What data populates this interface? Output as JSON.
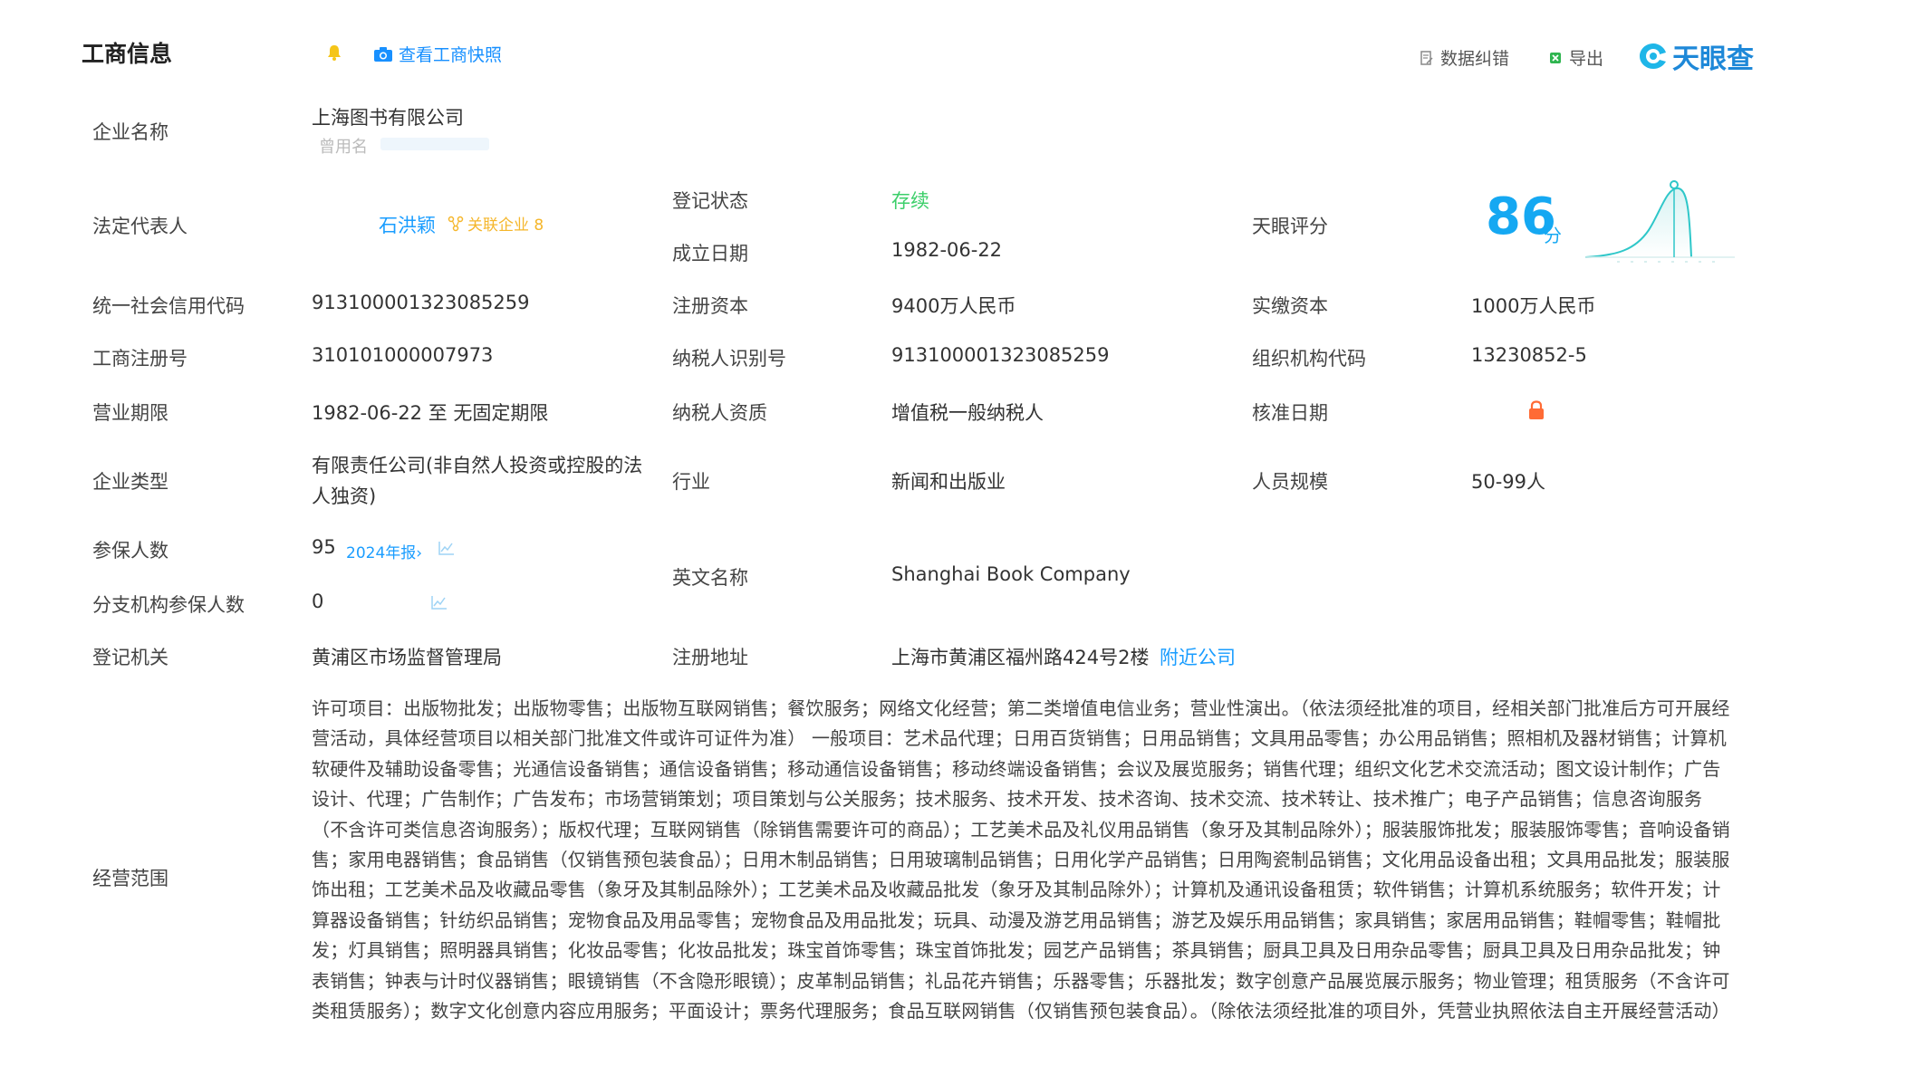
{
  "header": {
    "title": "工商信息",
    "snapshot_label": "查看工商快照",
    "data_correction_label": "数据纠错",
    "export_label": "导出",
    "brand": "天眼查"
  },
  "colors": {
    "accent": "#1a9dff",
    "status_green": "#3ccf6a",
    "score_blue": "#15a8f2",
    "lock_orange": "#ff6b35"
  },
  "rows": {
    "company_name_label": "企业名称",
    "company_name": "上海图书有限公司",
    "former_name_label": "曾用名",
    "legal_rep_label": "法定代表人",
    "legal_rep": "石洪颖",
    "related_companies": "关联企业 8",
    "reg_status_label": "登记状态",
    "reg_status": "存续",
    "founded_label": "成立日期",
    "founded": "1982-06-22",
    "tianyan_score_label": "天眼评分",
    "tianyan_score": "86",
    "tianyan_score_unit": "分",
    "credit_code_label": "统一社会信用代码",
    "credit_code": "913100001323085259",
    "reg_capital_label": "注册资本",
    "reg_capital": "9400万人民币",
    "paid_capital_label": "实缴资本",
    "paid_capital": "1000万人民币",
    "reg_no_label": "工商注册号",
    "reg_no": "310101000007973",
    "taxpayer_id_label": "纳税人识别号",
    "taxpayer_id": "913100001323085259",
    "org_code_label": "组织机构代码",
    "org_code": "13230852-5",
    "biz_term_label": "营业期限",
    "biz_term": "1982-06-22 至 无固定期限",
    "taxpayer_qual_label": "纳税人资质",
    "taxpayer_qual": "增值税一般纳税人",
    "approval_date_label": "核准日期",
    "company_type_label": "企业类型",
    "company_type_line1": "有限责任公司(非自然人投资或控股的法",
    "company_type_line2": "人独资)",
    "industry_label": "行业",
    "industry": "新闻和出版业",
    "staff_size_label": "人员规模",
    "staff_size": "50-99人",
    "insured_label": "参保人数",
    "insured": "95",
    "insured_year": "2024年报›",
    "branch_insured_label": "分支机构参保人数",
    "branch_insured": "0",
    "english_name_label": "英文名称",
    "english_name": "Shanghai Book Company",
    "authority_label": "登记机关",
    "authority": "黄浦区市场监督管理局",
    "address_label": "注册地址",
    "address": "上海市黄浦区福州路424号2楼",
    "nearby_label": "附近公司",
    "scope_label": "经营范围",
    "scope": "许可项目：出版物批发；出版物零售；出版物互联网销售；餐饮服务；网络文化经营；第二类增值电信业务；营业性演出。（依法须经批准的项目，经相关部门批准后方可开展经营活动，具体经营项目以相关部门批准文件或许可证件为准） 一般项目：艺术品代理；日用百货销售；日用品销售；文具用品零售；办公用品销售；照相机及器材销售；计算机软硬件及辅助设备零售；光通信设备销售；通信设备销售；移动通信设备销售；移动终端设备销售；会议及展览服务；销售代理；组织文化艺术交流活动；图文设计制作；广告设计、代理；广告制作；广告发布；市场营销策划；项目策划与公关服务；技术服务、技术开发、技术咨询、技术交流、技术转让、技术推广；电子产品销售；信息咨询服务（不含许可类信息咨询服务）；版权代理；互联网销售（除销售需要许可的商品）；工艺美术品及礼仪用品销售（象牙及其制品除外）；服装服饰批发；服装服饰零售；音响设备销售；家用电器销售；食品销售（仅销售预包装食品）；日用木制品销售；日用玻璃制品销售；日用化学产品销售；日用陶瓷制品销售；文化用品设备出租；文具用品批发；服装服饰出租；工艺美术品及收藏品零售（象牙及其制品除外）；工艺美术品及收藏品批发（象牙及其制品除外）；计算机及通讯设备租赁；软件销售；计算机系统服务；软件开发；计算器设备销售；针纺织品销售；宠物食品及用品零售；宠物食品及用品批发；玩具、动漫及游艺用品销售；游艺及娱乐用品销售；家具销售；家居用品销售；鞋帽零售；鞋帽批发；灯具销售；照明器具销售；化妆品零售；化妆品批发；珠宝首饰零售；珠宝首饰批发；园艺产品销售；茶具销售；厨具卫具及日用杂品零售；厨具卫具及日用杂品批发；钟表销售；钟表与计时仪器销售；眼镜销售（不含隐形眼镜）；皮革制品销售；礼品花卉销售；乐器零售；乐器批发；数字创意产品展览展示服务；物业管理；租赁服务（不含许可类租赁服务）；数字文化创意内容应用服务；平面设计；票务代理服务；食品互联网销售（仅销售预包装食品）。（除依法须经批准的项目外，凭营业执照依法自主开展经营活动）"
  }
}
